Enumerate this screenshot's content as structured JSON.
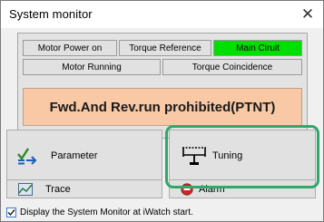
{
  "window": {
    "title": "System monitor",
    "close_symbol": "✕"
  },
  "status_panel": {
    "row1": [
      {
        "label": "Motor Power on",
        "active": false
      },
      {
        "label": "Torque Reference",
        "active": false
      },
      {
        "label": "Main Ciruit",
        "active": true
      }
    ],
    "row2": [
      {
        "label": "Motor Running",
        "active": false
      },
      {
        "label": "Torque Coincidence",
        "active": false
      }
    ],
    "warning": "Fwd.And Rev.run prohibited(PTNT)"
  },
  "buttons": {
    "parameter": {
      "label": "Parameter",
      "icon": "parameter-icon"
    },
    "tuning": {
      "label": "Tuning",
      "icon": "tuning-icon"
    },
    "trace": {
      "label": "Trace",
      "icon": "trace-icon"
    },
    "alarm": {
      "label": "Alarm",
      "icon": "alarm-icon"
    }
  },
  "footer": {
    "checkbox_label": "Display the System Monitor at iWatch start.",
    "checked": true
  },
  "colors": {
    "active_green": "#00e000",
    "warning_bg": "#f9c9a6",
    "highlight": "#2fa86a"
  }
}
